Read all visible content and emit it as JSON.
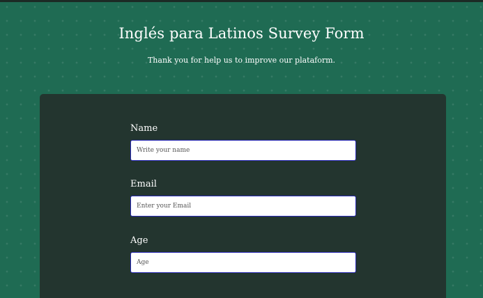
{
  "header": {
    "title": "Inglés para Latinos Survey Form",
    "description": "Thank you for help us to improve our plataform."
  },
  "form": {
    "name": {
      "label": "Name",
      "placeholder": "Write your name",
      "value": ""
    },
    "email": {
      "label": "Email",
      "placeholder": "Enter your Email",
      "value": ""
    },
    "age": {
      "label": "Age",
      "placeholder": "Age",
      "value": ""
    }
  },
  "colors": {
    "page_background": "#1f6b53",
    "card_background": "#23352f",
    "input_border": "#2a2ab8",
    "text": "#ffffff"
  }
}
